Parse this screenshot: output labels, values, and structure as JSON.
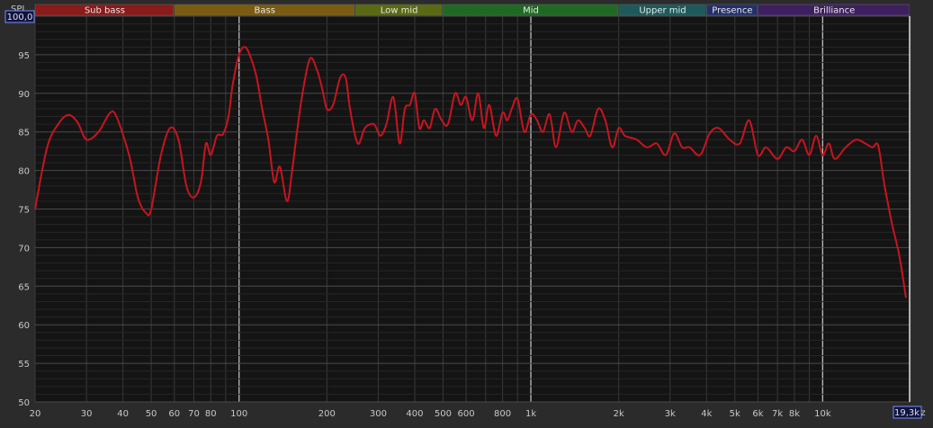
{
  "chart_data": {
    "type": "line",
    "title": "",
    "xlabel": "",
    "ylabel": "SPL",
    "x_scale": "log",
    "xlim": [
      20,
      20000
    ],
    "ylim": [
      50,
      100
    ],
    "grid": true,
    "y_top_readout": "100,0",
    "x_end_readout": "19,3k",
    "x_end_unit_suffix": "z",
    "y_ticks": [
      {
        "v": 95,
        "label": "95"
      },
      {
        "v": 90,
        "label": "90"
      },
      {
        "v": 85,
        "label": "85"
      },
      {
        "v": 80,
        "label": "80"
      },
      {
        "v": 75,
        "label": "75"
      },
      {
        "v": 70,
        "label": "70"
      },
      {
        "v": 65,
        "label": "65"
      },
      {
        "v": 60,
        "label": "60"
      },
      {
        "v": 55,
        "label": "55"
      },
      {
        "v": 50,
        "label": "50"
      }
    ],
    "x_ticks": [
      {
        "v": 20,
        "label": "20"
      },
      {
        "v": 30,
        "label": "30"
      },
      {
        "v": 40,
        "label": "40"
      },
      {
        "v": 50,
        "label": "50"
      },
      {
        "v": 60,
        "label": "60"
      },
      {
        "v": 70,
        "label": "70"
      },
      {
        "v": 80,
        "label": "80"
      },
      {
        "v": 100,
        "label": "100"
      },
      {
        "v": 200,
        "label": "200"
      },
      {
        "v": 300,
        "label": "300"
      },
      {
        "v": 400,
        "label": "400"
      },
      {
        "v": 500,
        "label": "500"
      },
      {
        "v": 600,
        "label": "600"
      },
      {
        "v": 800,
        "label": "800"
      },
      {
        "v": 1000,
        "label": "1k"
      },
      {
        "v": 2000,
        "label": "2k"
      },
      {
        "v": 3000,
        "label": "3k"
      },
      {
        "v": 4000,
        "label": "4k"
      },
      {
        "v": 5000,
        "label": "5k"
      },
      {
        "v": 6000,
        "label": "6k"
      },
      {
        "v": 7000,
        "label": "7k"
      },
      {
        "v": 8000,
        "label": "8k"
      },
      {
        "v": 10000,
        "label": "10k"
      }
    ],
    "major_x": [
      100,
      1000,
      10000
    ],
    "bands": [
      {
        "name": "Sub bass",
        "from": 20,
        "to": 60,
        "color": "#8b1a1a"
      },
      {
        "name": "Bass",
        "from": 60,
        "to": 250,
        "color": "#7a5c10"
      },
      {
        "name": "Low mid",
        "from": 250,
        "to": 500,
        "color": "#5a6a14"
      },
      {
        "name": "Mid",
        "from": 500,
        "to": 2000,
        "color": "#1e6a24"
      },
      {
        "name": "Upper mid",
        "from": 2000,
        "to": 4000,
        "color": "#1d5a5a"
      },
      {
        "name": "Presence",
        "from": 4000,
        "to": 6000,
        "color": "#24306a"
      },
      {
        "name": "Brilliance",
        "from": 6000,
        "to": 20000,
        "color": "#3e2060"
      }
    ],
    "series": [
      {
        "color": "#c8141e",
        "x": [
          20,
          22,
          24,
          26,
          28,
          30,
          33,
          36,
          38,
          42,
          45,
          48,
          50,
          54,
          58,
          62,
          66,
          70,
          74,
          77,
          80,
          84,
          88,
          92,
          95,
          100,
          105,
          110,
          115,
          120,
          126,
          132,
          138,
          146,
          152,
          158,
          165,
          175,
          185,
          193,
          200,
          210,
          222,
          232,
          240,
          255,
          270,
          290,
          305,
          320,
          338,
          355,
          370,
          385,
          400,
          415,
          430,
          450,
          470,
          495,
          520,
          550,
          575,
          600,
          630,
          660,
          690,
          720,
          760,
          800,
          830,
          860,
          900,
          950,
          1000,
          1050,
          1100,
          1160,
          1220,
          1300,
          1380,
          1450,
          1530,
          1600,
          1700,
          1800,
          1900,
          2000,
          2100,
          2300,
          2500,
          2700,
          2900,
          3100,
          3300,
          3500,
          3800,
          4100,
          4400,
          4800,
          5200,
          5600,
          6000,
          6400,
          7000,
          7500,
          8000,
          8500,
          9000,
          9500,
          10000,
          10500,
          11000,
          12000,
          13000,
          14000,
          14800,
          15500,
          16300,
          17300,
          18300,
          19300
        ],
        "y": [
          75,
          83,
          86,
          87.2,
          86.2,
          84,
          85,
          87.4,
          87,
          82,
          76.5,
          74.5,
          75,
          82,
          85.5,
          84,
          78,
          76.5,
          78.5,
          83.5,
          82,
          84.5,
          84.7,
          87,
          91,
          95,
          96,
          94.5,
          92,
          88,
          84,
          78.5,
          80.5,
          76,
          80,
          85,
          90,
          94.5,
          93,
          90.5,
          88,
          88.5,
          92,
          92,
          88,
          83.5,
          85.5,
          86,
          84.5,
          86,
          89.5,
          83.5,
          88,
          88.5,
          90,
          85.5,
          86.5,
          85.5,
          88,
          86.5,
          86,
          90,
          88.5,
          89.5,
          86.5,
          90,
          85.5,
          88.5,
          84.5,
          87.5,
          86.5,
          88,
          89.3,
          85,
          87.3,
          86.5,
          85,
          87.3,
          83,
          87.5,
          85,
          86.5,
          85.5,
          84.5,
          88,
          86.5,
          83,
          85.5,
          84.5,
          84,
          83,
          83.5,
          82,
          84.8,
          83,
          83,
          82,
          84.8,
          85.5,
          84,
          83.5,
          86.5,
          82,
          83,
          81.5,
          83,
          82.5,
          84,
          82,
          84.5,
          82,
          83.5,
          81.5,
          83,
          84,
          83.5,
          83,
          83.2,
          78,
          73,
          69,
          63.5
        ]
      }
    ]
  }
}
